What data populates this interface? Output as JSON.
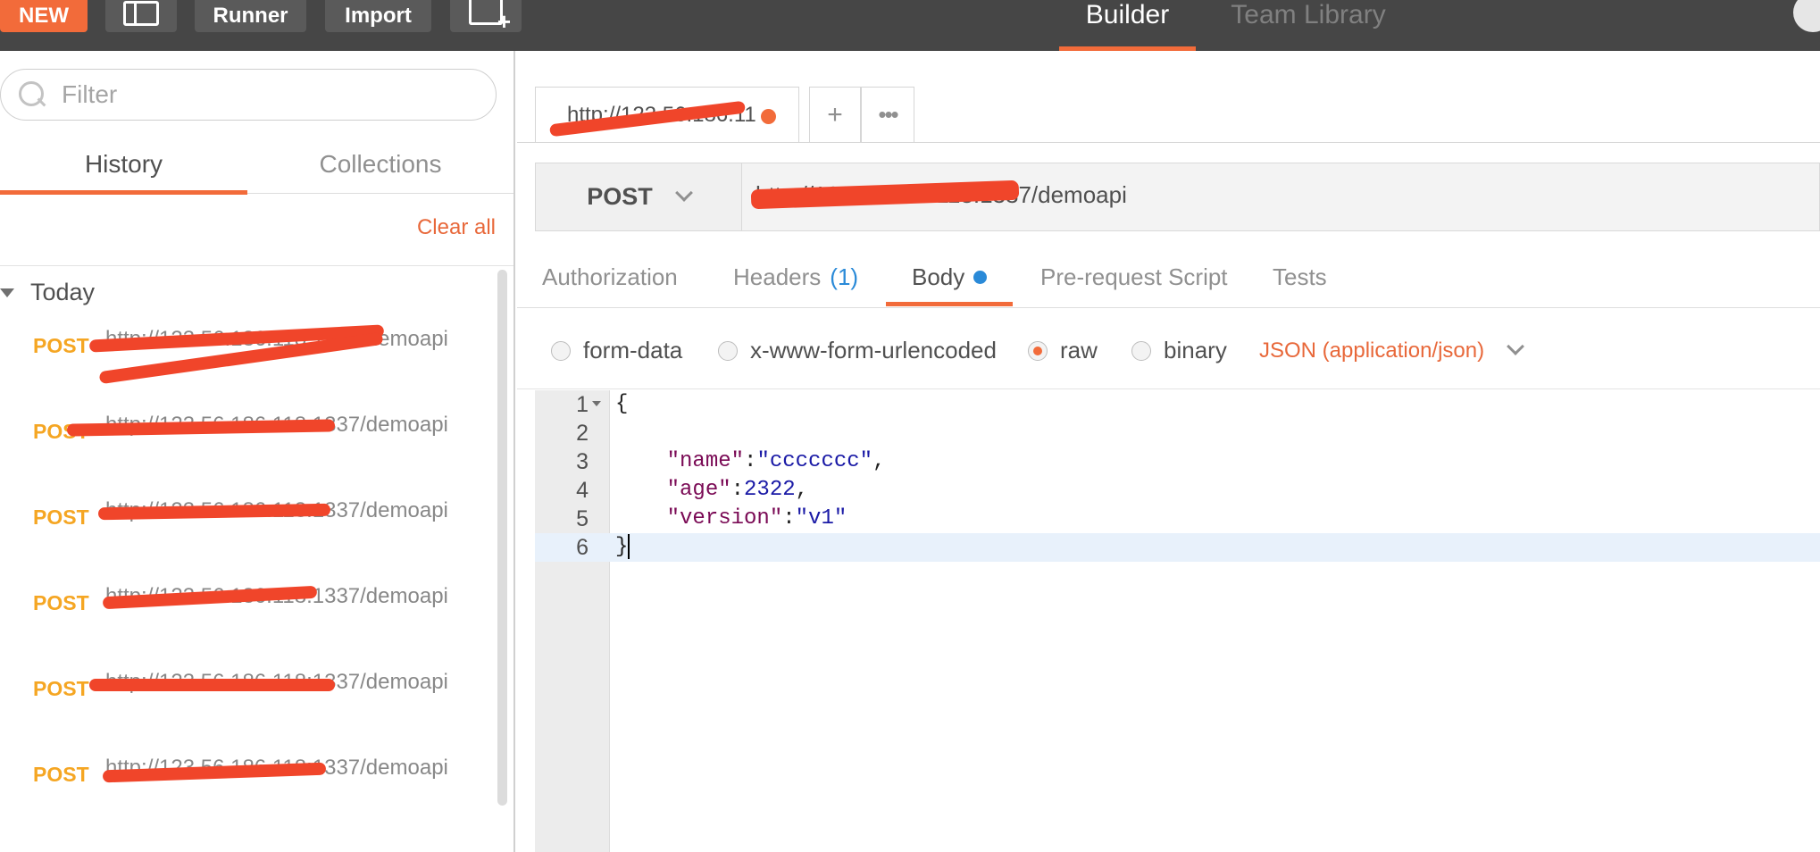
{
  "toolbar": {
    "new_label": "NEW",
    "runner_label": "Runner",
    "import_label": "Import",
    "tabs": [
      "Builder",
      "Team Library"
    ]
  },
  "sidebar": {
    "filter_placeholder": "Filter",
    "tabs": [
      "History",
      "Collections"
    ],
    "clear_all_label": "Clear all",
    "group_label": "Today",
    "history": [
      {
        "method": "POST",
        "url": "http://123.56.186.118:1337/demoapi"
      },
      {
        "method": "POST",
        "url": "http://123.56.186.118:1337/demoapi"
      },
      {
        "method": "POST",
        "url": "http://123.56.186.118:1337/demoapi"
      },
      {
        "method": "POST",
        "url": "http://123.56.186.118:1337/demoapi"
      },
      {
        "method": "POST",
        "url": "http://123.56.186.118:1337/demoapi"
      },
      {
        "method": "POST",
        "url": "http://123.56.186.118:1337/demoapi"
      }
    ]
  },
  "request": {
    "tab_label": "http://123.56.186.11",
    "method": "POST",
    "url": "http://123.56.186.118:1337/demoapi",
    "sub_tabs": {
      "authorization": "Authorization",
      "headers": "Headers",
      "headers_count": "(1)",
      "body": "Body",
      "prerequest": "Pre-request Script",
      "tests": "Tests"
    },
    "body_types": [
      "form-data",
      "x-www-form-urlencoded",
      "raw",
      "binary"
    ],
    "selected_body_type": "raw",
    "content_type": "JSON (application/json)",
    "code_lines": [
      "{",
      "",
      "    \"name\":\"ccccccc\",",
      "    \"age\":2322,",
      "    \"version\":\"v1\"",
      "}"
    ]
  },
  "colors": {
    "accent": "#f26b3a",
    "method_post": "#f5a623",
    "redaction": "#f0452a",
    "link_blue": "#2a8ad8"
  }
}
